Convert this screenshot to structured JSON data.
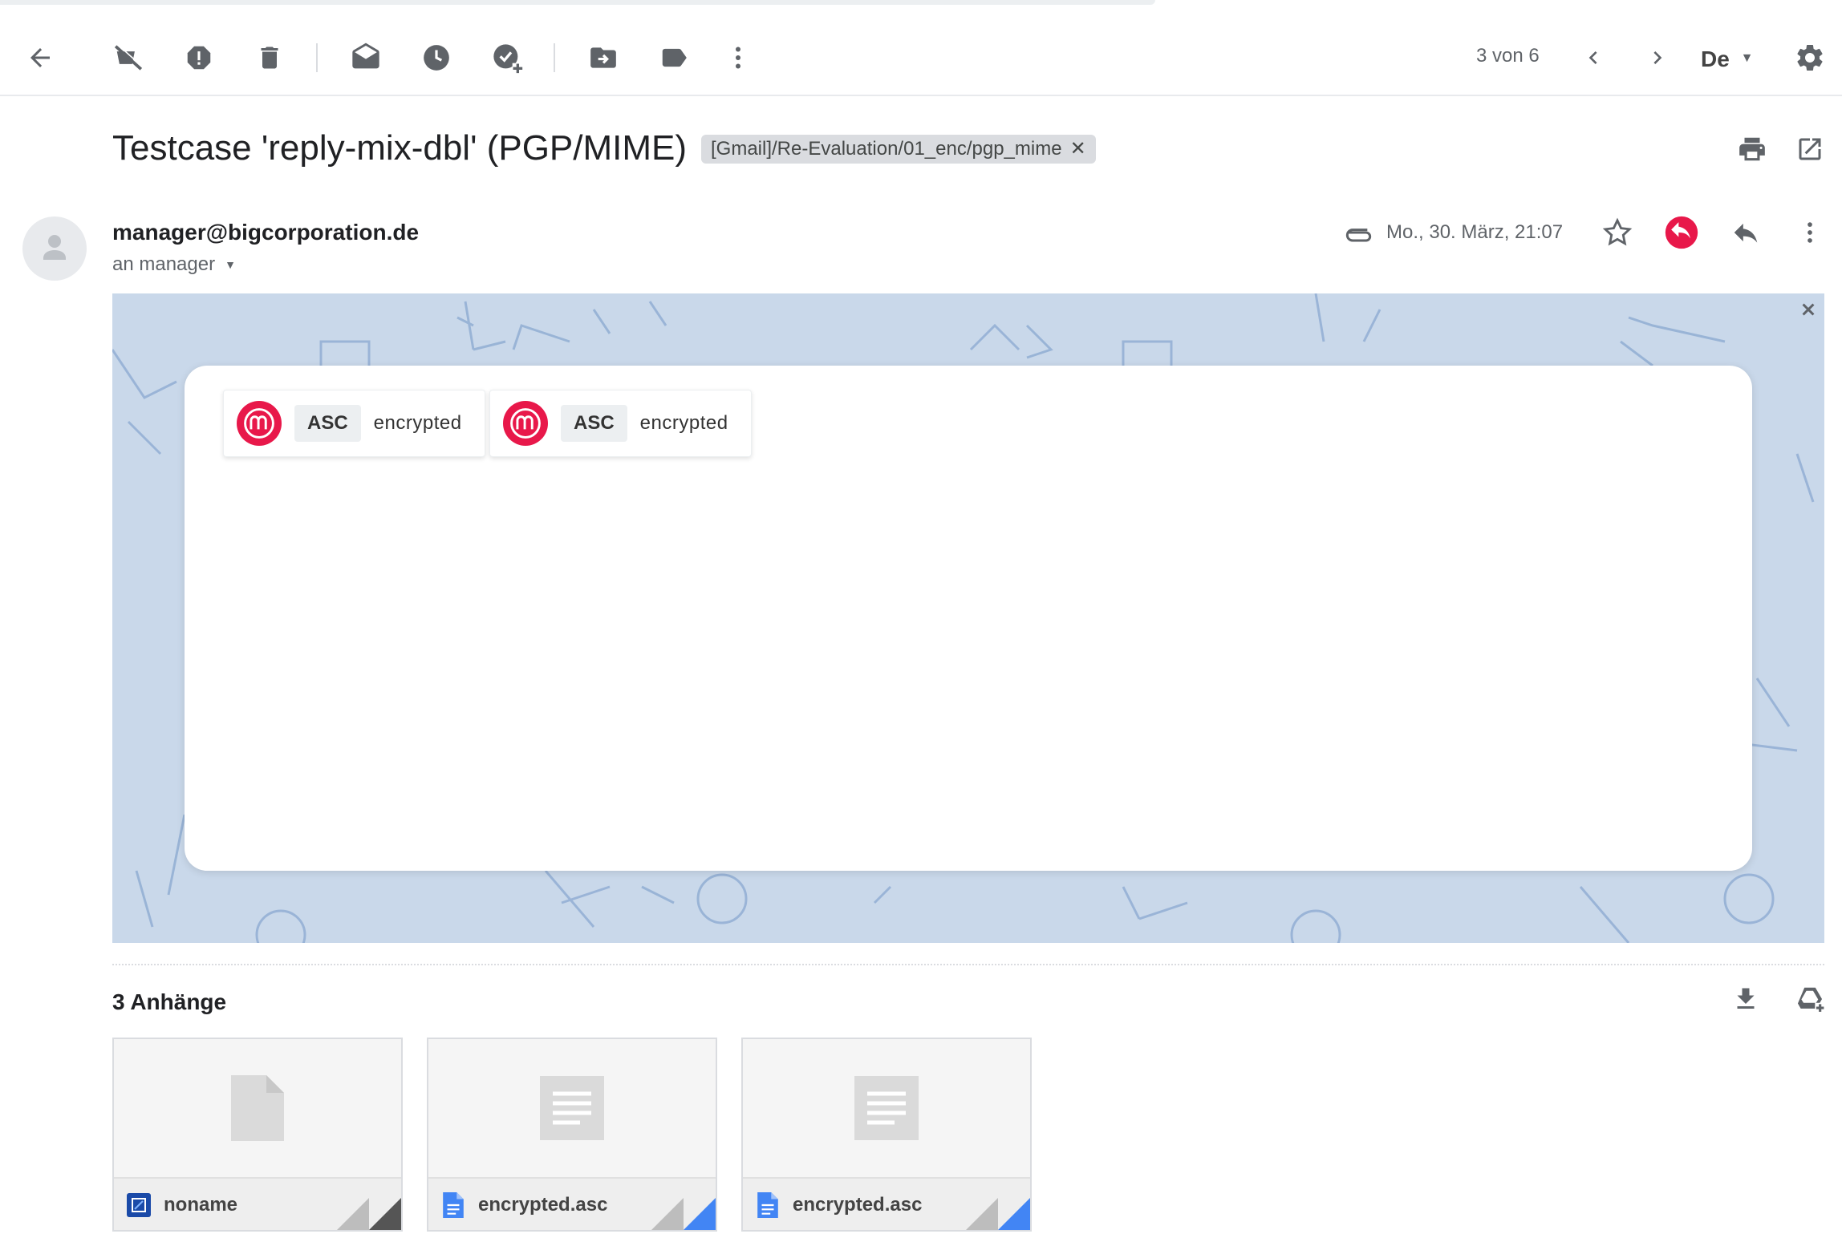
{
  "toolbar": {
    "pager_text": "3 von 6",
    "lang": "De"
  },
  "message": {
    "subject": "Testcase 'reply-mix-dbl' (PGP/MIME)",
    "label": "[Gmail]/Re-Evaluation/01_enc/pgp_mime",
    "sender": "manager@bigcorporation.de",
    "recipient": "an manager",
    "date": "Mo., 30. März, 21:07"
  },
  "encrypted_chips": [
    {
      "type": "ASC",
      "status": "encrypted"
    },
    {
      "type": "ASC",
      "status": "encrypted"
    }
  ],
  "attachments": {
    "count_label": "3 Anhänge",
    "items": [
      {
        "name": "noname",
        "type_icon": "generic-file-icon",
        "type_color": "#1a4aa8"
      },
      {
        "name": "encrypted.asc",
        "type_icon": "doc-icon",
        "type_color": "#4285f4"
      },
      {
        "name": "encrypted.asc",
        "type_icon": "doc-icon",
        "type_color": "#4285f4"
      }
    ]
  },
  "colors": {
    "mailvelope_red": "#e8184a",
    "banner_bg": "#c9d8ea",
    "label_chip": "#dadce0"
  }
}
